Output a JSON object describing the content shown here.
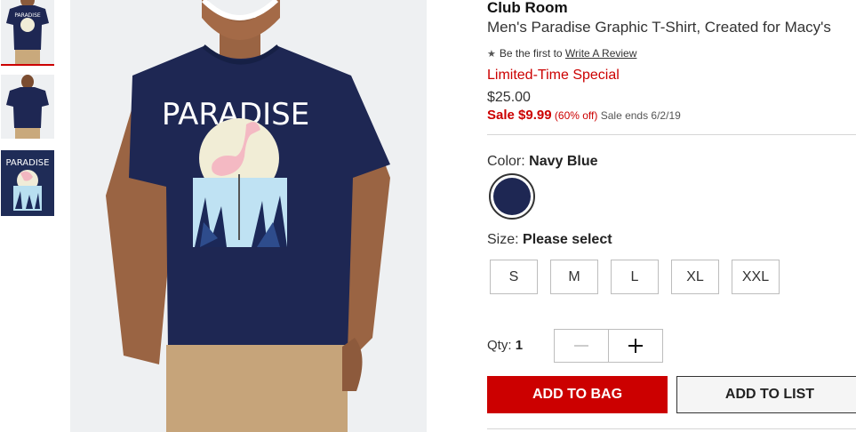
{
  "thumbnails": [
    {
      "name": "thumb-front-model",
      "graphic_text": "PARADISE"
    },
    {
      "name": "thumb-back-model"
    },
    {
      "name": "thumb-graphic-closeup",
      "graphic_text": "PARADISE"
    }
  ],
  "main_image": {
    "graphic_text": "PARADISE",
    "shirt_color": "#1e2753"
  },
  "product": {
    "brand": "Club Room",
    "title": "Men's Paradise Graphic T-Shirt, Created for Macy's",
    "review_prefix": "Be the first to",
    "review_link": "Write A Review",
    "promo": "Limited-Time Special",
    "original_price": "$25.00",
    "sale_label": "Sale $9.99",
    "discount": "(60% off)",
    "sale_ends": "Sale ends 6/2/19"
  },
  "color": {
    "label": "Color:",
    "selected": "Navy Blue",
    "swatch_hex": "#1e2753"
  },
  "size": {
    "label": "Size:",
    "selected": "Please select",
    "options": [
      "S",
      "M",
      "L",
      "XL",
      "XXL"
    ]
  },
  "quantity": {
    "label": "Qty:",
    "value": "1"
  },
  "actions": {
    "add_to_bag": "ADD TO BAG",
    "add_to_list": "ADD TO LIST"
  },
  "colors": {
    "accent_red": "#cc0000",
    "navy": "#1e2753"
  },
  "icons": [
    "star-icon",
    "minus-icon",
    "plus-icon"
  ]
}
